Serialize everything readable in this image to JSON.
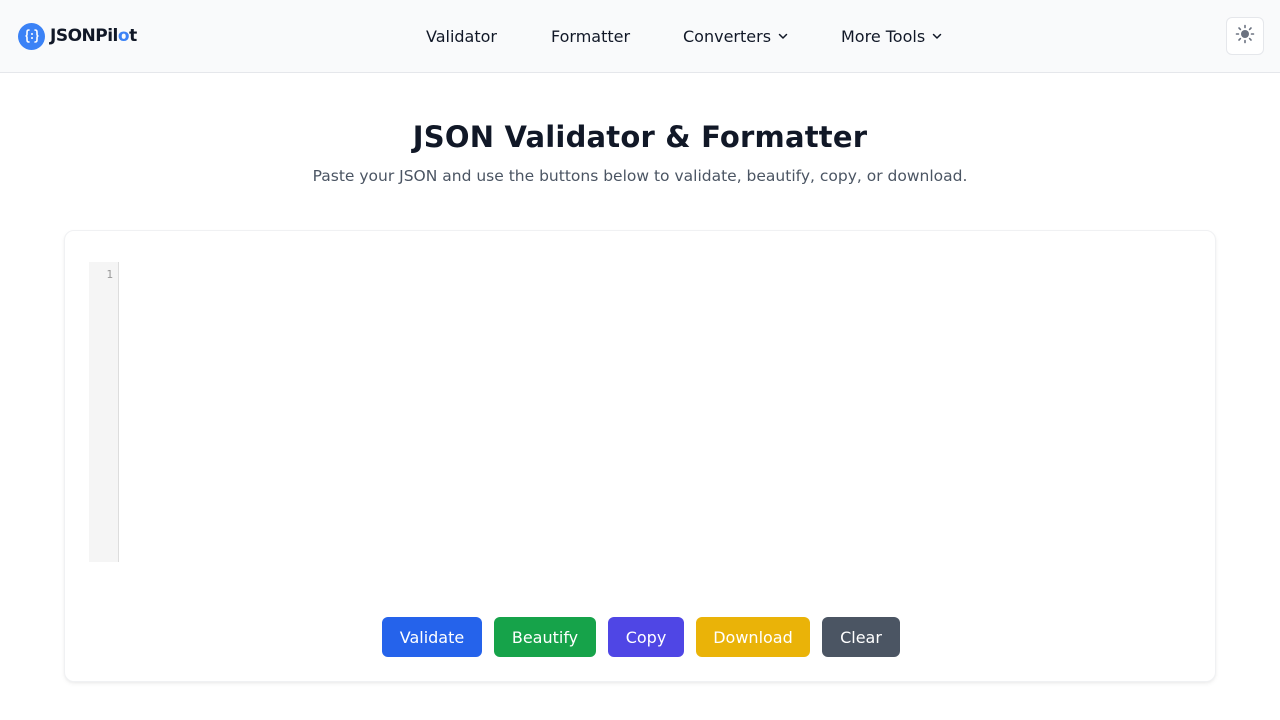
{
  "header": {
    "brand": {
      "name_main": "JSONPil",
      "name_accent": "o",
      "name_end": "t"
    },
    "nav": [
      {
        "label": "Validator",
        "dropdown": false
      },
      {
        "label": "Formatter",
        "dropdown": false
      },
      {
        "label": "Converters",
        "dropdown": true
      },
      {
        "label": "More Tools",
        "dropdown": true
      }
    ],
    "theme_toggle_icon": "sun-icon"
  },
  "hero": {
    "title": "JSON Validator & Formatter",
    "subtitle": "Paste your JSON and use the buttons below to validate, beautify, copy, or download."
  },
  "editor": {
    "line_numbers": [
      "1"
    ],
    "value": ""
  },
  "actions": [
    {
      "label": "Validate",
      "color": "#2563eb"
    },
    {
      "label": "Beautify",
      "color": "#16a34a"
    },
    {
      "label": "Copy",
      "color": "#4f46e5"
    },
    {
      "label": "Download",
      "color": "#eab308"
    },
    {
      "label": "Clear",
      "color": "#4b5563"
    }
  ],
  "colors": {
    "brand": "#3b82f6",
    "header_bg": "#f9fafb"
  }
}
